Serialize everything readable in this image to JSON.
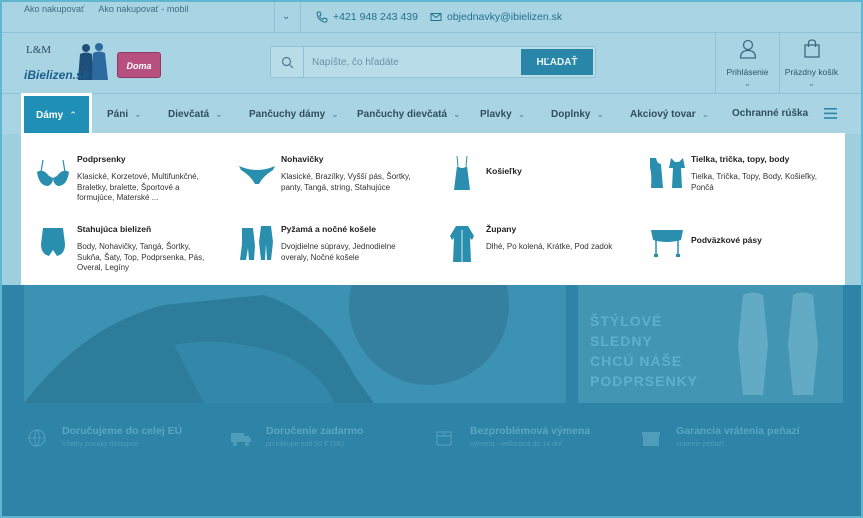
{
  "topbar": {
    "links": [
      "Ako nakupovať",
      "Ako nakupovať - mobil"
    ],
    "phone": "+421 948 243 439",
    "email": "objednavky@ibielizen.sk"
  },
  "header": {
    "logo_text": "iBielizen.sk",
    "logo_brand": "L&M",
    "badge_text": "Doma",
    "search_placeholder": "Napíšte, čo hľadáte",
    "search_button": "HĽADAŤ",
    "login_label": "Prihlásenie",
    "cart_label": "Prázdny košík"
  },
  "nav": {
    "items": [
      "Dámy",
      "Páni",
      "Dievčatá",
      "Pančuchy dámy",
      "Pančuchy dievčatá",
      "Plavky",
      "Doplnky",
      "Akciový tovar",
      "Ochranné rúška"
    ]
  },
  "dropdown": {
    "categories": [
      {
        "title": "Podprsenky",
        "desc": "Klasické, Korzetové, Multifunkčné, Braletky, bralette, Športové a formujúce, Materské ..."
      },
      {
        "title": "Nohavičky",
        "desc": "Klasické, Brazílky, Vyšší pás, Šortky, panty, Tangá, string, Stahujúce"
      },
      {
        "title": "Košieľky",
        "desc": ""
      },
      {
        "title": "Tielka, trička, topy, body",
        "desc": "Tielka, Trička, Topy, Body, Košieľky, Pončá"
      },
      {
        "title": "Stahujúca bielizeň",
        "desc": "Body, Nohavičky, Tangá, Šortky, Sukňa, Šaty, Top, Podprsenka, Pás, Overal, Legíny"
      },
      {
        "title": "Pyžamá a nočné košele",
        "desc": "Dvojdielne súpravy, Jednodielne overaly, Nočné košele"
      },
      {
        "title": "Župany",
        "desc": "Dlhé, Po kolená, Krátke, Pod zadok"
      },
      {
        "title": "Podväzkové pásy",
        "desc": ""
      }
    ]
  },
  "hero": {
    "right_lines": [
      "ŠTÝLOVÉ",
      "SLEDNY",
      "CHCÚ NÁŠE",
      "PODPRSENKY"
    ]
  },
  "usps": [
    {
      "title": "Doručujeme do celej EÚ",
      "sub": "Všetky ponuky dostupné"
    },
    {
      "title": "Doručenie zadarmo",
      "sub": "pri nákupe nad 50 € (SK)"
    },
    {
      "title": "Bezproblémová výmena",
      "sub": "výmena - veľkostná do 14 dní"
    },
    {
      "title": "Garancia vrátenia peňazí",
      "sub": "vrátenie peňazí"
    }
  ],
  "colors": {
    "accent": "#1f8fb5",
    "icon": "#2a8fae"
  }
}
